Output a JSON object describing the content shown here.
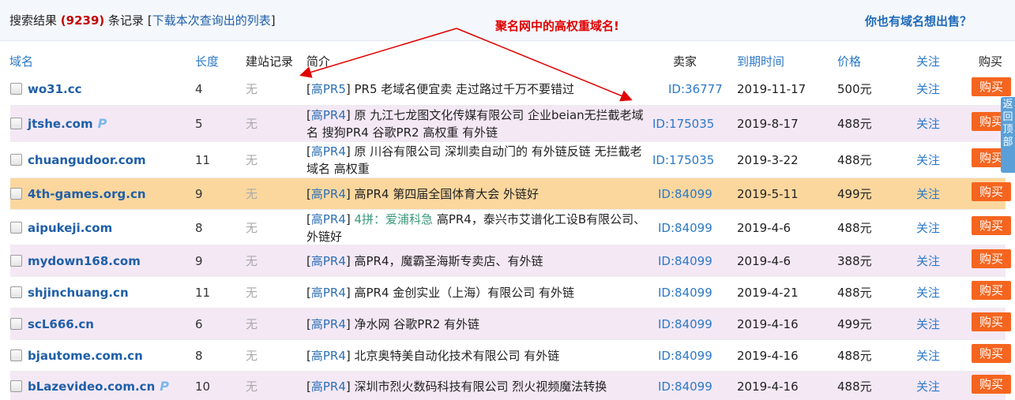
{
  "header": {
    "prefix": "搜索结果",
    "count": "(9239)",
    "suffix": "条记录",
    "download_link": "下载本次查询出的列表",
    "annotation": "聚名网中的高权重域名!",
    "sell_link": "你也有域名想出售？"
  },
  "columns": {
    "domain": "域名",
    "length": "长度",
    "record": "建站记录",
    "intro": "简介",
    "seller": "卖家",
    "expire": "到期时间",
    "price": "价格",
    "follow": "关注",
    "buy": "购买"
  },
  "rows": [
    {
      "domain": "wo31.cc",
      "p": "",
      "length": "4",
      "record": "无",
      "tag": "高PR5",
      "extra": "",
      "intro": "PR5 老域名便宜卖 走过路过千万不要错过",
      "seller": "ID:36777",
      "expire": "2019-11-17",
      "price": "500元",
      "follow": "关注",
      "buy": "购买"
    },
    {
      "domain": "jtshe.com",
      "p": "P",
      "length": "5",
      "record": "无",
      "tag": "高PR4",
      "extra": "",
      "intro": "原 九江七龙图文化传媒有限公司 企业beian无拦截老域名 搜狗PR4 谷歌PR2 高权重 有外链",
      "seller": "ID:175035",
      "expire": "2019-8-17",
      "price": "488元",
      "follow": "关注",
      "buy": "购买"
    },
    {
      "domain": "chuangudoor.com",
      "p": "",
      "length": "11",
      "record": "无",
      "tag": "高PR4",
      "extra": "",
      "intro": "原 川谷有限公司 深圳卖自动门的 有外链反链 无拦截老域名 高权重",
      "seller": "ID:175035",
      "expire": "2019-3-22",
      "price": "488元",
      "follow": "关注",
      "buy": "购买"
    },
    {
      "domain": "4th-games.org.cn",
      "p": "",
      "length": "9",
      "record": "无",
      "tag": "高PR4",
      "extra": "",
      "intro": "高PR4 第四届全国体育大会 外链好",
      "seller": "ID:84099",
      "expire": "2019-5-11",
      "price": "499元",
      "follow": "关注",
      "buy": "购买"
    },
    {
      "domain": "aipukeji.com",
      "p": "",
      "length": "8",
      "record": "无",
      "tag": "高PR4",
      "extra": "4拼：爱浦科急",
      "intro": "高PR4，泰兴市艾谱化工设B有限公司、外链好",
      "seller": "ID:84099",
      "expire": "2019-4-6",
      "price": "488元",
      "follow": "关注",
      "buy": "购买"
    },
    {
      "domain": "mydown168.com",
      "p": "",
      "length": "9",
      "record": "无",
      "tag": "高PR4",
      "extra": "",
      "intro": "高PR4，魔霸圣海斯专卖店、有外链",
      "seller": "ID:84099",
      "expire": "2019-4-6",
      "price": "388元",
      "follow": "关注",
      "buy": "购买"
    },
    {
      "domain": "shjinchuang.cn",
      "p": "",
      "length": "11",
      "record": "无",
      "tag": "高PR4",
      "extra": "",
      "intro": "高PR4 金创实业（上海）有限公司 有外链",
      "seller": "ID:84099",
      "expire": "2019-4-21",
      "price": "488元",
      "follow": "关注",
      "buy": "购买"
    },
    {
      "domain": "scL666.cn",
      "p": "",
      "length": "6",
      "record": "无",
      "tag": "高PR4",
      "extra": "",
      "intro": "净水网 谷歌PR2 有外链",
      "seller": "ID:84099",
      "expire": "2019-4-16",
      "price": "499元",
      "follow": "关注",
      "buy": "购买"
    },
    {
      "domain": "bjautome.com.cn",
      "p": "",
      "length": "8",
      "record": "无",
      "tag": "高PR4",
      "extra": "",
      "intro": "北京奥特美自动化技术有限公司 有外链",
      "seller": "ID:84099",
      "expire": "2019-4-16",
      "price": "488元",
      "follow": "关注",
      "buy": "购买"
    },
    {
      "domain": "bLazevideo.com.cn",
      "p": "P",
      "length": "10",
      "record": "无",
      "tag": "高PR4",
      "extra": "",
      "intro": "深圳市烈火数码科技有限公司 烈火视频魔法转换",
      "seller": "ID:84099",
      "expire": "2019-4-16",
      "price": "488元",
      "follow": "关注",
      "buy": "购买"
    }
  ],
  "side_tab": "返回顶部",
  "colors": {
    "accent": "#2c79c8",
    "buy": "#f5651f",
    "annotation": "#e00000",
    "highlight_row": "#fbd79e",
    "alt_row": "#f4e8f5"
  }
}
